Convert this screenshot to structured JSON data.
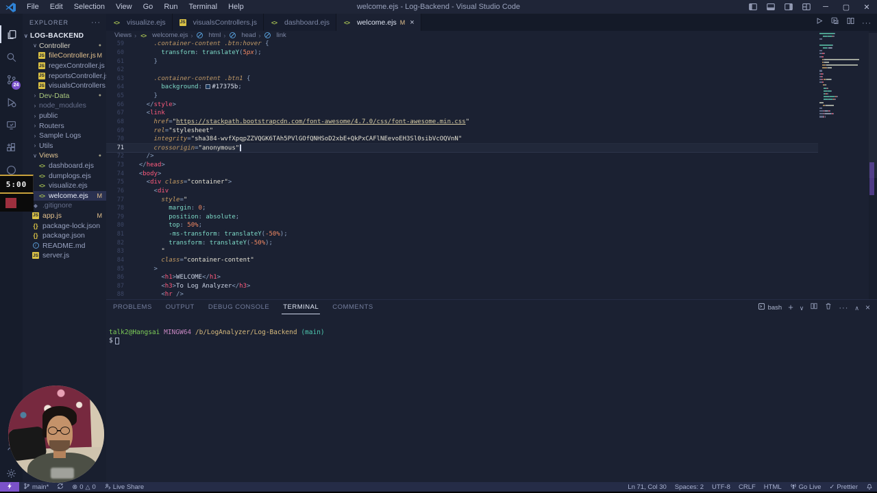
{
  "window": {
    "title": "welcome.ejs - Log-Backend - Visual Studio Code",
    "menus": [
      "File",
      "Edit",
      "Selection",
      "View",
      "Go",
      "Run",
      "Terminal",
      "Help"
    ],
    "controls": [
      {
        "name": "layout-sidebar-icon"
      },
      {
        "name": "layout-panel-icon"
      },
      {
        "name": "layout-secondary-icon"
      },
      {
        "name": "layout-customize-icon"
      },
      {
        "name": "minimize-button",
        "glyph": "─"
      },
      {
        "name": "restore-button",
        "glyph": "▢"
      },
      {
        "name": "close-button",
        "glyph": "✕"
      }
    ]
  },
  "activity_bar": {
    "items": [
      {
        "name": "explorer",
        "icon": "files",
        "active": true
      },
      {
        "name": "search",
        "icon": "search"
      },
      {
        "name": "source-control",
        "icon": "scm",
        "badge": "24"
      },
      {
        "name": "run-debug",
        "icon": "debug"
      },
      {
        "name": "remote-explorer",
        "icon": "remote"
      },
      {
        "name": "extensions",
        "icon": "extensions"
      },
      {
        "name": "github",
        "icon": "github"
      },
      {
        "name": "docs",
        "icon": "book"
      },
      {
        "name": "accounts",
        "icon": "account",
        "bottom": 0
      },
      {
        "name": "settings",
        "icon": "gear",
        "bottom": 1
      }
    ]
  },
  "explorer": {
    "header": "EXPLORER",
    "more": "···",
    "root": "LOG-BACKEND",
    "items": [
      {
        "label": "Controller",
        "kind": "folder",
        "depth": 1,
        "expanded": true,
        "dot": true,
        "status": "cream"
      },
      {
        "label": "fileController.js",
        "kind": "file",
        "icon": "js",
        "depth": 2,
        "badge": "M",
        "status": "mod"
      },
      {
        "label": "regexController.js",
        "kind": "file",
        "icon": "js",
        "depth": 2
      },
      {
        "label": "reportsController.js",
        "kind": "file",
        "icon": "js",
        "depth": 2
      },
      {
        "label": "visualsControllers.js",
        "kind": "file",
        "icon": "js",
        "depth": 2
      },
      {
        "label": "Dev-Data",
        "kind": "folder",
        "depth": 1,
        "dot": true,
        "status": "untracked"
      },
      {
        "label": "node_modules",
        "kind": "folder",
        "depth": 1,
        "status": "ignored"
      },
      {
        "label": "public",
        "kind": "folder",
        "depth": 1
      },
      {
        "label": "Routers",
        "kind": "folder",
        "depth": 1
      },
      {
        "label": "Sample Logs",
        "kind": "folder",
        "depth": 1
      },
      {
        "label": "Utils",
        "kind": "folder",
        "depth": 1
      },
      {
        "label": "Views",
        "kind": "folder",
        "depth": 1,
        "expanded": true,
        "dot": true,
        "status": "tan"
      },
      {
        "label": "dashboard.ejs",
        "kind": "file",
        "icon": "ejs",
        "depth": 2
      },
      {
        "label": "dumplogs.ejs",
        "kind": "file",
        "icon": "ejs",
        "depth": 2
      },
      {
        "label": "visualize.ejs",
        "kind": "file",
        "icon": "ejs",
        "depth": 2
      },
      {
        "label": "welcome.ejs",
        "kind": "file",
        "icon": "ejs",
        "depth": 2,
        "badge": "M",
        "selected": true,
        "status": "sel"
      },
      {
        "label": ".gitignore",
        "kind": "file",
        "icon": "git",
        "depth": 1,
        "status": "ignored"
      },
      {
        "label": "app.js",
        "kind": "file",
        "icon": "js",
        "depth": 1,
        "badge": "M",
        "status": "mod"
      },
      {
        "label": "package-lock.json",
        "kind": "file",
        "icon": "json",
        "depth": 1
      },
      {
        "label": "package.json",
        "kind": "file",
        "icon": "json",
        "depth": 1
      },
      {
        "label": "README.md",
        "kind": "file",
        "icon": "info",
        "depth": 1
      },
      {
        "label": "server.js",
        "kind": "file",
        "icon": "js",
        "depth": 1
      }
    ]
  },
  "tabs": [
    {
      "label": "visualize.ejs",
      "icon": "ejs"
    },
    {
      "label": "visualsControllers.js",
      "icon": "js"
    },
    {
      "label": "dashboard.ejs",
      "icon": "ejs"
    },
    {
      "label": "welcome.ejs",
      "icon": "ejs",
      "active": true,
      "modified": "M",
      "closable": true
    }
  ],
  "editor_actions": [
    {
      "name": "run",
      "icon": "play"
    },
    {
      "name": "run-or-debug",
      "icon": "runalt"
    },
    {
      "name": "split-editor",
      "icon": "split"
    },
    {
      "name": "more-actions",
      "icon": "more"
    }
  ],
  "breadcrumbs": [
    {
      "label": "Views"
    },
    {
      "label": "welcome.ejs",
      "icon": "ejs"
    },
    {
      "label": "html",
      "icon": "sym"
    },
    {
      "label": "head",
      "icon": "sym"
    },
    {
      "label": "link",
      "icon": "sym"
    }
  ],
  "editor": {
    "cursor_line": 71,
    "lines": [
      {
        "n": 59,
        "t": [
          [
            "sel",
            "      .container-content .btn:hover "
          ],
          [
            "pun",
            "{"
          ]
        ]
      },
      {
        "n": 60,
        "t": [
          [
            "ws",
            "        "
          ],
          [
            "prop",
            "transform"
          ],
          [
            "pun",
            ": "
          ],
          [
            "fn",
            "translateY"
          ],
          [
            "pun",
            "("
          ],
          [
            "num",
            "5"
          ],
          [
            "unit",
            "px"
          ],
          [
            "pun",
            ");"
          ]
        ]
      },
      {
        "n": 61,
        "t": [
          [
            "pun",
            "      }"
          ]
        ]
      },
      {
        "n": 62,
        "t": []
      },
      {
        "n": 63,
        "t": [
          [
            "sel",
            "      .container-content .btn1 "
          ],
          [
            "pun",
            "{"
          ]
        ]
      },
      {
        "n": 64,
        "t": [
          [
            "ws",
            "        "
          ],
          [
            "prop",
            "background"
          ],
          [
            "pun",
            ": "
          ],
          [
            "sw",
            ""
          ],
          [
            "hex",
            "#17375b"
          ],
          [
            "pun",
            ";"
          ]
        ]
      },
      {
        "n": 65,
        "t": [
          [
            "pun",
            "      }"
          ]
        ]
      },
      {
        "n": 66,
        "t": [
          [
            "pun",
            "    </"
          ],
          [
            "tag",
            "style"
          ],
          [
            "pun",
            ">"
          ]
        ]
      },
      {
        "n": 67,
        "t": [
          [
            "pun",
            "    <"
          ],
          [
            "tag",
            "link"
          ]
        ]
      },
      {
        "n": 68,
        "t": [
          [
            "ws",
            "      "
          ],
          [
            "attr",
            "href"
          ],
          [
            "pun",
            "="
          ],
          [
            "str",
            "\""
          ],
          [
            "lnk",
            "https://stackpath.bootstrapcdn.com/font-awesome/4.7.0/css/font-awesome.min.css"
          ],
          [
            "str",
            "\""
          ]
        ]
      },
      {
        "n": 69,
        "t": [
          [
            "ws",
            "      "
          ],
          [
            "attr",
            "rel"
          ],
          [
            "pun",
            "="
          ],
          [
            "str",
            "\"stylesheet\""
          ]
        ]
      },
      {
        "n": 70,
        "t": [
          [
            "ws",
            "      "
          ],
          [
            "attr",
            "integrity"
          ],
          [
            "pun",
            "="
          ],
          [
            "str",
            "\"sha384-wvfXpqpZZVQGK6TAh5PVlGOfQNHSoD2xbE+QkPxCAFlNEevoEH3Sl0sibVcOQVnN\""
          ]
        ]
      },
      {
        "n": 71,
        "t": [
          [
            "ws",
            "      "
          ],
          [
            "attr",
            "crossorigin"
          ],
          [
            "pun",
            "="
          ],
          [
            "str",
            "\"anonymous\""
          ]
        ]
      },
      {
        "n": 72,
        "t": [
          [
            "pun",
            "    />"
          ]
        ]
      },
      {
        "n": 73,
        "t": [
          [
            "pun",
            "  </"
          ],
          [
            "tag",
            "head"
          ],
          [
            "pun",
            ">"
          ]
        ]
      },
      {
        "n": 74,
        "t": [
          [
            "pun",
            "  <"
          ],
          [
            "tag",
            "body"
          ],
          [
            "pun",
            ">"
          ]
        ]
      },
      {
        "n": 75,
        "t": [
          [
            "pun",
            "    <"
          ],
          [
            "tag",
            "div"
          ],
          [
            "ws",
            " "
          ],
          [
            "attr",
            "class"
          ],
          [
            "pun",
            "="
          ],
          [
            "str",
            "\"container\""
          ],
          [
            "pun",
            ">"
          ]
        ]
      },
      {
        "n": 76,
        "t": [
          [
            "pun",
            "      <"
          ],
          [
            "tag",
            "div"
          ]
        ]
      },
      {
        "n": 77,
        "t": [
          [
            "ws",
            "        "
          ],
          [
            "attr",
            "style"
          ],
          [
            "pun",
            "="
          ],
          [
            "str",
            "\""
          ]
        ]
      },
      {
        "n": 78,
        "t": [
          [
            "ws",
            "          "
          ],
          [
            "prop",
            "margin"
          ],
          [
            "pun",
            ": "
          ],
          [
            "num",
            "0"
          ],
          [
            "pun",
            ";"
          ]
        ]
      },
      {
        "n": 79,
        "t": [
          [
            "ws",
            "          "
          ],
          [
            "prop",
            "position"
          ],
          [
            "pun",
            ": "
          ],
          [
            "val",
            "absolute"
          ],
          [
            "pun",
            ";"
          ]
        ]
      },
      {
        "n": 80,
        "t": [
          [
            "ws",
            "          "
          ],
          [
            "prop",
            "top"
          ],
          [
            "pun",
            ": "
          ],
          [
            "num",
            "50"
          ],
          [
            "unit",
            "%"
          ],
          [
            "pun",
            ";"
          ]
        ]
      },
      {
        "n": 81,
        "t": [
          [
            "ws",
            "          "
          ],
          [
            "prop",
            "-ms-transform"
          ],
          [
            "pun",
            ": "
          ],
          [
            "fn",
            "translateY"
          ],
          [
            "pun",
            "("
          ],
          [
            "num",
            "-50"
          ],
          [
            "unit",
            "%"
          ],
          [
            "pun",
            ");"
          ]
        ]
      },
      {
        "n": 82,
        "t": [
          [
            "ws",
            "          "
          ],
          [
            "prop",
            "transform"
          ],
          [
            "pun",
            ": "
          ],
          [
            "fn",
            "translateY"
          ],
          [
            "pun",
            "("
          ],
          [
            "num",
            "-50"
          ],
          [
            "unit",
            "%"
          ],
          [
            "pun",
            ");"
          ]
        ]
      },
      {
        "n": 83,
        "t": [
          [
            "str",
            "        \""
          ]
        ]
      },
      {
        "n": 84,
        "t": [
          [
            "ws",
            "        "
          ],
          [
            "attr",
            "class"
          ],
          [
            "pun",
            "="
          ],
          [
            "str",
            "\"container-content\""
          ]
        ]
      },
      {
        "n": 85,
        "t": [
          [
            "pun",
            "      >"
          ]
        ]
      },
      {
        "n": 86,
        "t": [
          [
            "pun",
            "        <"
          ],
          [
            "tag",
            "h1"
          ],
          [
            "pun",
            ">"
          ],
          [
            "txt",
            "WELCOME"
          ],
          [
            "pun",
            "</"
          ],
          [
            "tag",
            "h1"
          ],
          [
            "pun",
            ">"
          ]
        ]
      },
      {
        "n": 87,
        "t": [
          [
            "pun",
            "        <"
          ],
          [
            "tag",
            "h3"
          ],
          [
            "pun",
            ">"
          ],
          [
            "txt",
            "To Log Analyzer"
          ],
          [
            "pun",
            "</"
          ],
          [
            "tag",
            "h3"
          ],
          [
            "pun",
            ">"
          ]
        ]
      },
      {
        "n": 88,
        "t": [
          [
            "pun",
            "        <"
          ],
          [
            "tag",
            "hr"
          ],
          [
            "ws",
            " "
          ],
          [
            "pun",
            "/>"
          ]
        ]
      }
    ]
  },
  "panel": {
    "tabs": [
      {
        "label": "PROBLEMS"
      },
      {
        "label": "OUTPUT"
      },
      {
        "label": "DEBUG CONSOLE"
      },
      {
        "label": "TERMINAL",
        "active": true
      },
      {
        "label": "COMMENTS"
      }
    ],
    "shell": "bash",
    "actions": [
      {
        "name": "new-terminal",
        "icon": "plus"
      },
      {
        "name": "terminal-picker",
        "icon": "chevdown"
      },
      {
        "name": "split-terminal",
        "icon": "split"
      },
      {
        "name": "kill-terminal",
        "icon": "trash"
      },
      {
        "name": "more",
        "icon": "more"
      },
      {
        "name": "maximize-panel",
        "icon": "chevup"
      },
      {
        "name": "close-panel",
        "icon": "close"
      }
    ],
    "terminal": {
      "user": "talk2@Hangsai",
      "env": "MINGW64",
      "path": "/b/LogAnalyzer/Log-Backend",
      "branch": "(main)",
      "prompt": "$"
    }
  },
  "status_bar": {
    "left": [
      {
        "name": "remote",
        "icon": "bolt",
        "accent": true
      },
      {
        "name": "branch",
        "icon": "branch",
        "label": "main*"
      },
      {
        "name": "sync",
        "icon": "sync"
      },
      {
        "name": "problems",
        "icon": "error",
        "label": "0",
        "icon2": "warning",
        "label2": "0"
      },
      {
        "name": "live-share",
        "icon": "liveshare",
        "label": "Live Share"
      }
    ],
    "right": [
      {
        "name": "cursor-position",
        "label": "Ln 71, Col 30"
      },
      {
        "name": "indentation",
        "label": "Spaces: 2"
      },
      {
        "name": "encoding",
        "label": "UTF-8"
      },
      {
        "name": "eol",
        "label": "CRLF"
      },
      {
        "name": "language-mode",
        "label": "HTML"
      },
      {
        "name": "go-live",
        "icon": "golive",
        "label": "Go Live"
      },
      {
        "name": "prettier",
        "icon": "check",
        "label": "Prettier"
      },
      {
        "name": "notifications",
        "icon": "bell"
      }
    ]
  },
  "overlay": {
    "timer_text": "5:00"
  },
  "colors": {
    "accent_purple": "#7b52c9",
    "modified": "#e2c08d",
    "badge": "#7a52cc",
    "css_swatch": "#17375b"
  }
}
